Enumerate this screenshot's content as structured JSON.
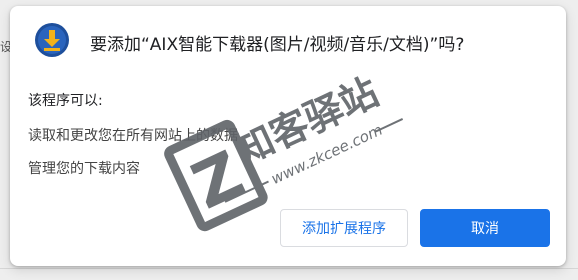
{
  "background": {
    "edge_text": "设程"
  },
  "dialog": {
    "title": "要添加“AIX智能下载器(图片/视频/音乐/文档)”吗?",
    "icon": "download-arrow-icon",
    "icon_bg_color": "#1e4f9c",
    "icon_fg_color": "#f2b21b",
    "permissions_heading": "该程序可以:",
    "permissions": [
      "读取和更改您在所有网站上的数据",
      "管理您的下载内容"
    ],
    "add_button_label": "添加扩展程序",
    "cancel_button_label": "取消"
  },
  "watermark": {
    "letter": "Z",
    "brand": "知客驿站",
    "url": "www.zkcee.com",
    "color": "#5f6368"
  },
  "colors": {
    "primary": "#1a73e8",
    "text": "#202124"
  }
}
